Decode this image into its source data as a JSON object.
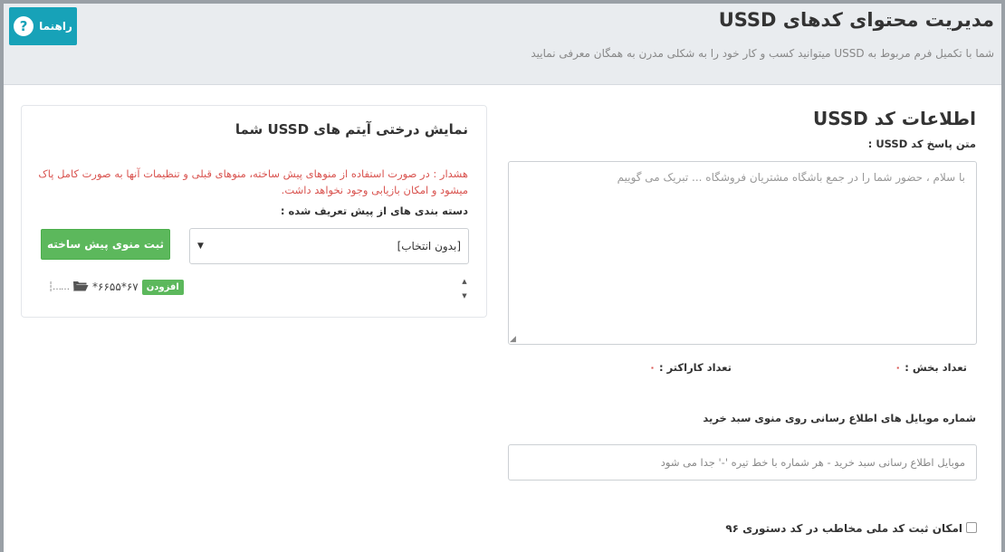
{
  "header": {
    "title": "مدیریت محتوای کدهای USSD",
    "subtitle": "شما با تکمیل فرم مربوط به USSD میتوانید کسب و کار خود را به شکلی مدرن به همگان معرفی نمایید",
    "help_label": "راهنما",
    "help_icon": "question-circle-icon"
  },
  "ussd_info": {
    "title": "اطلاعات کد USSD",
    "response_label": "متن پاسخ کد USSD :",
    "response_placeholder": "با سلام ، حضور شما را در جمع باشگاه مشتریان فروشگاه ... تبریک می گوییم",
    "parts_label": "تعداد بخش :",
    "parts_value": "۰",
    "chars_label": "تعداد کاراکتر :",
    "chars_value": "۰",
    "mobile_label": "شماره موبایل های اطلاع رسانی روی منوی سبد خرید",
    "mobile_placeholder": "موبایل اطلاع رسانی سبد خرید - هر شماره با خط تیره '-' جدا می شود",
    "national_code_label": "امکان ثبت کد ملی مخاطب در کد دستوری ۹۶",
    "national_code_checked": false
  },
  "tree_panel": {
    "title": "نمایش درختی آیتم های USSD شما",
    "warning": "هشدار : در صورت استفاده از منوهای پیش ساخته، منوهای قبلی و تنظیمات آنها به صورت کامل پاک میشود و امکان بازیابی وجود نخواهد داشت.",
    "category_label": "دسته بندی های از پیش تعریف شده :",
    "category_selected": "[بدون انتخاب]",
    "submit_label": "ثبت منوی پیش ساخته",
    "tree_node_label": "*۶۶۵۵*۶۷",
    "tree_add_label": "افزودن",
    "folder_icon": "folder-open-icon"
  }
}
